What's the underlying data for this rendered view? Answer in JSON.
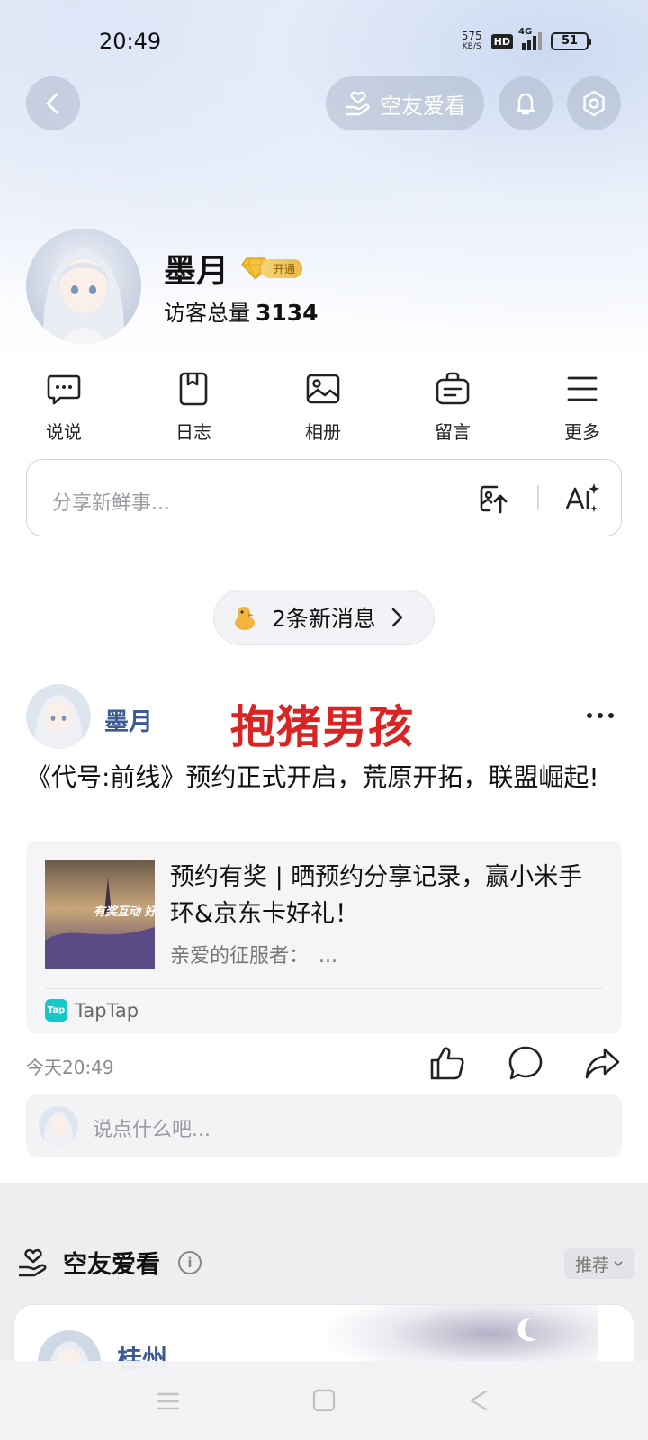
{
  "status_bar": {
    "time": "20:49",
    "net_speed_value": "575",
    "net_speed_unit": "KB/S",
    "hd": "HD",
    "network": "4G",
    "battery": "51"
  },
  "header": {
    "friends_watch_button": "空友爱看"
  },
  "profile": {
    "name": "墨月",
    "vip_open": "开通",
    "visitors_label": "访客总量",
    "visitors_count": "3134"
  },
  "quick_nav": [
    {
      "label": "说说",
      "icon": "chat-bubble-icon"
    },
    {
      "label": "日志",
      "icon": "notebook-icon"
    },
    {
      "label": "相册",
      "icon": "photo-icon"
    },
    {
      "label": "留言",
      "icon": "message-board-icon"
    },
    {
      "label": "更多",
      "icon": "menu-icon"
    }
  ],
  "share": {
    "placeholder": "分享新鲜事..."
  },
  "new_messages": {
    "label": "2条新消息"
  },
  "post": {
    "author": "墨月",
    "overlay_text": "抱猪男孩",
    "text": "《代号:前线》预约正式开启，荒原开拓，联盟崛起!",
    "card": {
      "title": "预约有奖 | 晒预约分享记录，赢小米手环&京东卡好礼！",
      "description": "亲爱的征服者：　...",
      "thumb_text": "有奖互动 好",
      "source_logo": "Tap",
      "source": "TapTap"
    },
    "time": "今天20:49",
    "comment_placeholder": "说点什么吧..."
  },
  "friends_section": {
    "title": "空友爱看",
    "info": "i",
    "sort_label": "推荐",
    "first_friend_name": "桂州"
  },
  "colors": {
    "accent_name": "#3d5b93",
    "overlay_red": "#d82424",
    "taptap": "#14c8c8"
  }
}
